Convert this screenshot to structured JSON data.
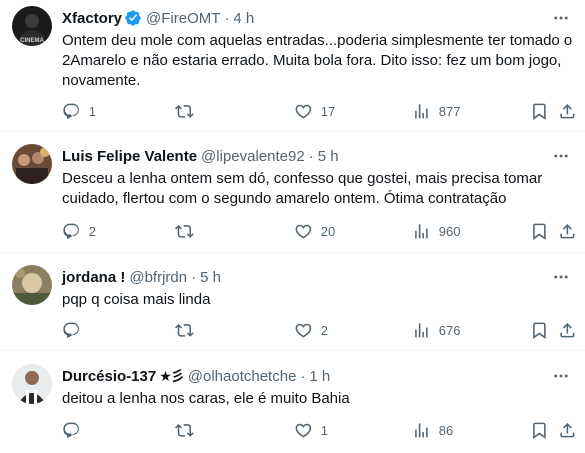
{
  "tweets": [
    {
      "name": "Xfactory",
      "verified": true,
      "handle": "@FireOMT",
      "time": "4 h",
      "text": "Ontem deu mole com aquelas entradas...poderia simplesmente ter tomado o 2Amarelo e não estaria errado. Muita bola fora. Dito isso: fez um bom jogo, novamente.",
      "replies": "1",
      "retweets": "",
      "likes": "17",
      "views": "877",
      "avatar_text": "CINEMA"
    },
    {
      "name": "Luis Felipe Valente",
      "handle": "@lipevalente92",
      "time": "5 h",
      "text": "Desceu a lenha ontem sem dó, confesso que gostei, mais precisa tomar cuidado, flertou com o segundo amarelo ontem. Ótima contratação",
      "replies": "2",
      "retweets": "",
      "likes": "20",
      "views": "960"
    },
    {
      "name": "jordana !",
      "handle": "@bfrjrdn",
      "time": "5 h",
      "text": "pqp q coisa mais linda",
      "replies": "",
      "retweets": "",
      "likes": "2",
      "views": "676"
    },
    {
      "name": "Durcésio-137",
      "name_suffix": "★彡",
      "handle": "@olhaotchetche",
      "time": "1 h",
      "text": "deitou a lenha nos caras, ele é muito Bahia",
      "replies": "",
      "retweets": "",
      "likes": "1",
      "views": "86"
    }
  ],
  "colors": {
    "text": "#0f1419",
    "muted": "#536471",
    "verified": "#1d9bf0",
    "divider": "#eff3f4"
  },
  "icons": [
    "reply-icon",
    "retweet-icon",
    "like-icon",
    "views-icon",
    "bookmark-icon",
    "share-icon",
    "more-icon",
    "verified-badge-icon"
  ]
}
